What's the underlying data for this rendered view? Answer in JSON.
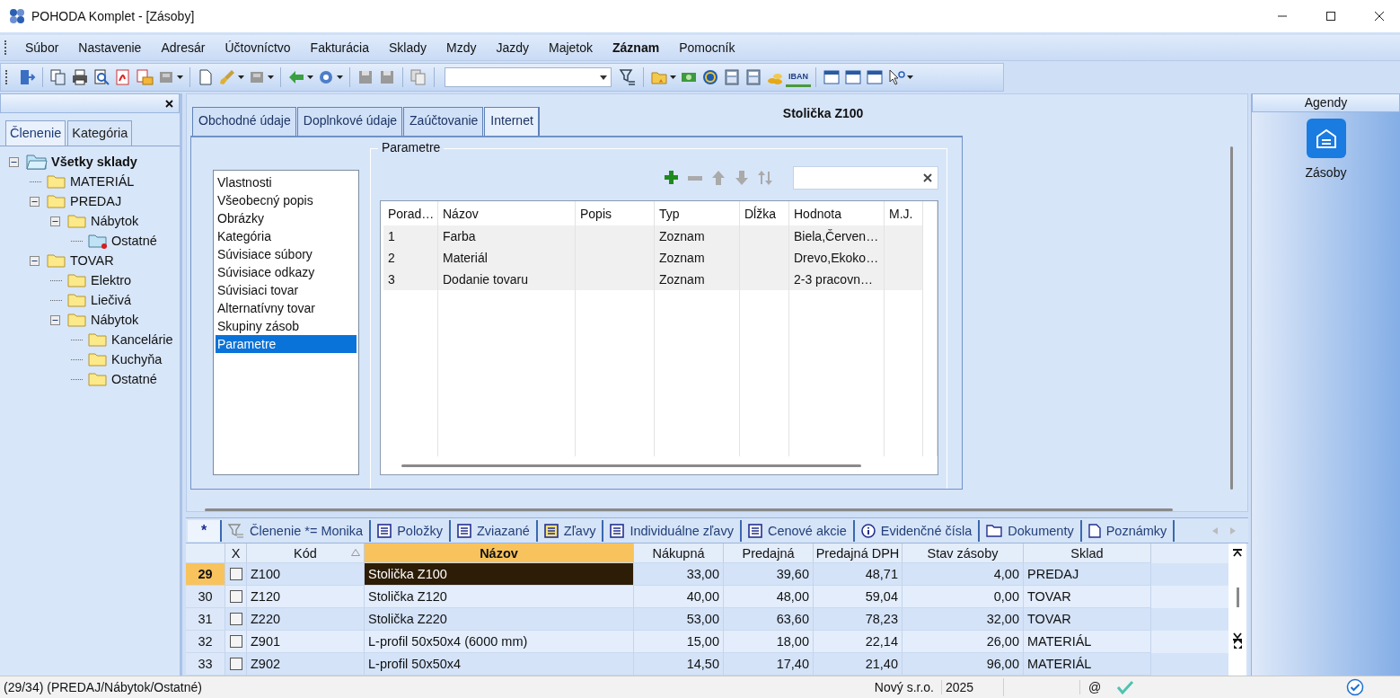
{
  "window": {
    "title": "POHODA Komplet - [Zásoby]"
  },
  "menu": [
    {
      "label": "Súbor",
      "bold": false
    },
    {
      "label": "Nastavenie",
      "bold": false
    },
    {
      "label": "Adresár",
      "bold": false
    },
    {
      "label": "Účtovníctvo",
      "bold": false
    },
    {
      "label": "Fakturácia",
      "bold": false
    },
    {
      "label": "Sklady",
      "bold": false
    },
    {
      "label": "Mzdy",
      "bold": false
    },
    {
      "label": "Jazdy",
      "bold": false
    },
    {
      "label": "Majetok",
      "bold": false
    },
    {
      "label": "Záznam",
      "bold": true
    },
    {
      "label": "Pomocník",
      "bold": false
    }
  ],
  "toolbar": {
    "iban_label": "IBAN"
  },
  "left_panel": {
    "tabs": [
      {
        "label": "Členenie",
        "selected": true
      },
      {
        "label": "Kategória",
        "selected": false
      }
    ],
    "tree": [
      {
        "label": "Všetky sklady",
        "kind": "root",
        "expanded": true,
        "children": [
          {
            "label": "MATERIÁL",
            "kind": "folder"
          },
          {
            "label": "PREDAJ",
            "kind": "folder",
            "expanded": true,
            "children": [
              {
                "label": "Nábytok",
                "kind": "folder",
                "expanded": true,
                "children": [
                  {
                    "label": "Ostatné",
                    "kind": "marked"
                  }
                ]
              }
            ]
          },
          {
            "label": "TOVAR",
            "kind": "folder",
            "expanded": true,
            "children": [
              {
                "label": "Elektro",
                "kind": "folder"
              },
              {
                "label": "Liečivá",
                "kind": "folder"
              },
              {
                "label": "Nábytok",
                "kind": "folder",
                "expanded": true,
                "children": [
                  {
                    "label": "Kancelárie",
                    "kind": "folder"
                  },
                  {
                    "label": "Kuchyňa",
                    "kind": "folder"
                  },
                  {
                    "label": "Ostatné",
                    "kind": "folder"
                  }
                ]
              }
            ]
          }
        ]
      }
    ]
  },
  "form": {
    "tabs": [
      {
        "label": "Obchodné údaje",
        "selected": false
      },
      {
        "label": "Doplnkové údaje",
        "selected": false
      },
      {
        "label": "Zaúčtovanie",
        "selected": false
      },
      {
        "label": "Internet",
        "selected": true
      }
    ],
    "title": "Stolička Z100",
    "sections": [
      {
        "label": "Vlastnosti",
        "selected": false
      },
      {
        "label": "Všeobecný popis",
        "selected": false
      },
      {
        "label": "Obrázky",
        "selected": false
      },
      {
        "label": "Kategória",
        "selected": false
      },
      {
        "label": "Súvisiace súbory",
        "selected": false
      },
      {
        "label": "Súvisiace odkazy",
        "selected": false
      },
      {
        "label": "Súvisiaci tovar",
        "selected": false
      },
      {
        "label": "Alternatívny tovar",
        "selected": false
      },
      {
        "label": "Skupiny zásob",
        "selected": false
      },
      {
        "label": "Parametre",
        "selected": true
      }
    ],
    "parameters": {
      "title": "Parametre",
      "columns": [
        "Porad…",
        "Názov",
        "Popis",
        "Typ",
        "Dĺžka",
        "Hodnota",
        "M.J."
      ],
      "rows": [
        [
          "1",
          "Farba",
          "",
          "Zoznam",
          "",
          "Biela,Červen…",
          ""
        ],
        [
          "2",
          "Materiál",
          "",
          "Zoznam",
          "",
          "Drevo,Ekoko…",
          ""
        ],
        [
          "3",
          "Dodanie tovaru",
          "",
          "Zoznam",
          "",
          "2-3 pracovn…",
          ""
        ]
      ]
    }
  },
  "detail_tabs": [
    {
      "label": "*",
      "kind": "star",
      "selected": true
    },
    {
      "label": "Členenie *= Monika",
      "kind": "filter",
      "selected": false
    },
    {
      "label": "Položky",
      "kind": "list",
      "selected": false
    },
    {
      "label": "Zviazané",
      "kind": "list",
      "selected": false
    },
    {
      "label": "Zľavy",
      "kind": "list-yellow",
      "selected": false
    },
    {
      "label": "Individuálne zľavy",
      "kind": "list",
      "selected": false
    },
    {
      "label": "Cenové akcie",
      "kind": "list",
      "selected": false
    },
    {
      "label": "Evidenčné čísla",
      "kind": "info",
      "selected": false
    },
    {
      "label": "Dokumenty",
      "kind": "folder",
      "selected": false
    },
    {
      "label": "Poznámky",
      "kind": "page",
      "selected": false
    }
  ],
  "grid": {
    "checkbox_column": "X",
    "columns": [
      {
        "label": "Kód",
        "sorted": true,
        "active": false
      },
      {
        "label": "Názov",
        "sorted": false,
        "active": true
      },
      {
        "label": "Nákupná",
        "sorted": false,
        "active": false
      },
      {
        "label": "Predajná",
        "sorted": false,
        "active": false
      },
      {
        "label": "Predajná DPH",
        "sorted": false,
        "active": false
      },
      {
        "label": "Stav zásoby",
        "sorted": false,
        "active": false
      },
      {
        "label": "Sklad",
        "sorted": false,
        "active": false
      }
    ],
    "rows": [
      {
        "number": "29",
        "checked": false,
        "selected": true,
        "cells": [
          "Z100",
          "Stolička Z100",
          "33,00",
          "39,60",
          "48,71",
          "4,00",
          "PREDAJ"
        ]
      },
      {
        "number": "30",
        "checked": false,
        "selected": false,
        "cells": [
          "Z120",
          "Stolička Z120",
          "40,00",
          "48,00",
          "59,04",
          "0,00",
          "TOVAR"
        ]
      },
      {
        "number": "31",
        "checked": false,
        "selected": false,
        "cells": [
          "Z220",
          "Stolička Z220",
          "53,00",
          "63,60",
          "78,23",
          "32,00",
          "TOVAR"
        ]
      },
      {
        "number": "32",
        "checked": false,
        "selected": false,
        "cells": [
          "Z901",
          "L-profil 50x50x4 (6000 mm)",
          "15,00",
          "18,00",
          "22,14",
          "26,00",
          "MATERIÁL"
        ]
      },
      {
        "number": "33",
        "checked": false,
        "selected": false,
        "cells": [
          "Z902",
          "L-profil 50x50x4",
          "14,50",
          "17,40",
          "21,40",
          "96,00",
          "MATERIÁL"
        ]
      }
    ]
  },
  "agendas": {
    "title": "Agendy",
    "items": [
      {
        "label": "Zásoby"
      }
    ]
  },
  "status_bar": {
    "record": "(29/34) (PREDAJ/Nábytok/Ostatné)",
    "company": "Nový s.r.o.",
    "year": "2025",
    "mail": "@"
  }
}
